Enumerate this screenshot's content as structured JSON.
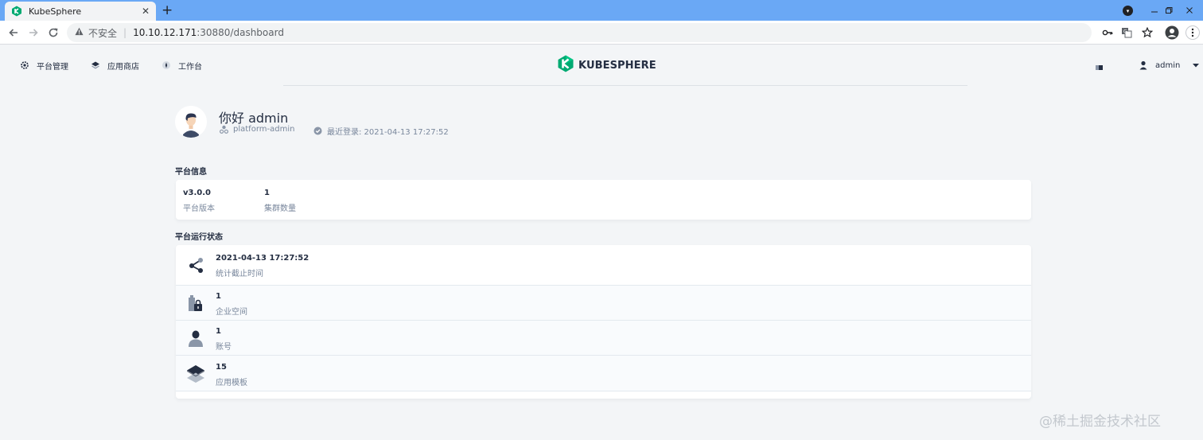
{
  "browser": {
    "tab_title": "KubeSphere",
    "tab_close": "✕",
    "new_tab": "+",
    "insecure_label": "不安全",
    "url_host": "10.10.12.171",
    "url_path": ":30880/dashboard"
  },
  "header": {
    "nav": [
      {
        "label": "平台管理",
        "icon": "gear-icon"
      },
      {
        "label": "应用商店",
        "icon": "layers-icon"
      },
      {
        "label": "工作台",
        "icon": "compass-icon"
      }
    ],
    "logo_text": "KUBESPHERE",
    "user_name": "admin"
  },
  "profile": {
    "greeting": "你好 admin",
    "role": "platform-admin",
    "last_login": "最近登录: 2021-04-13 17:27:52"
  },
  "platform_info": {
    "title": "平台信息",
    "items": [
      {
        "value": "v3.0.0",
        "label": "平台版本"
      },
      {
        "value": "1",
        "label": "集群数量"
      }
    ]
  },
  "platform_status": {
    "title": "平台运行状态",
    "items": [
      {
        "value": "2021-04-13 17:27:52",
        "label": "统计截止时间",
        "icon": "share-nodes-icon"
      },
      {
        "value": "1",
        "label": "企业空间",
        "icon": "enterprise-space-icon"
      },
      {
        "value": "1",
        "label": "账号",
        "icon": "user-icon"
      },
      {
        "value": "15",
        "label": "应用模板",
        "icon": "app-template-icon"
      }
    ]
  },
  "watermark": "@稀土掘金技术社区",
  "colors": {
    "tabbar": "#6aa8f5",
    "brand_green": "#00aa72",
    "page_bg": "#f3f5f7",
    "text_dark": "#242e42",
    "text_muted": "#79879c"
  }
}
